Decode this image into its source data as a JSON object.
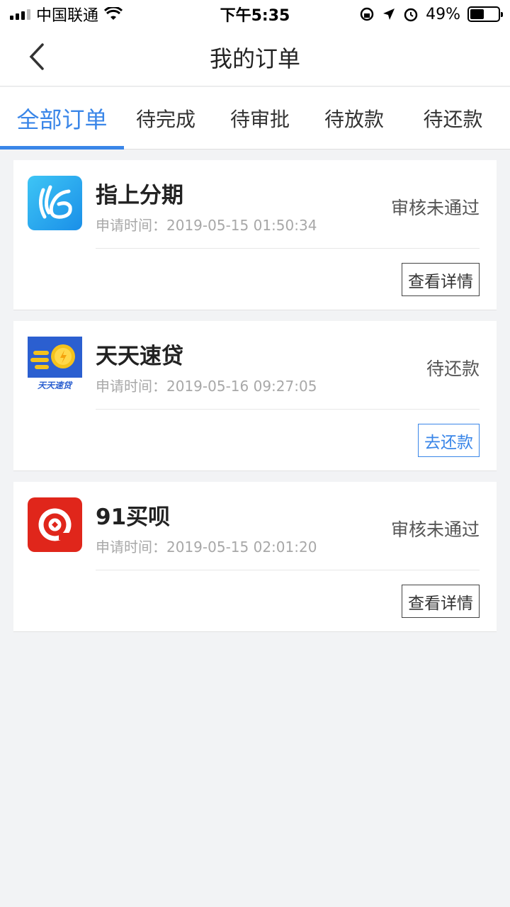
{
  "status_bar": {
    "carrier": "中国联通",
    "time": "下午5:35",
    "battery": "49%",
    "battery_level": 0.49
  },
  "header": {
    "title": "我的订单",
    "back_icon": "chevron-left-icon"
  },
  "tabs": [
    {
      "label": "全部订单",
      "active": true
    },
    {
      "label": "待完成",
      "active": false
    },
    {
      "label": "待审批",
      "active": false
    },
    {
      "label": "待放款",
      "active": false
    },
    {
      "label": "待还款",
      "active": false
    }
  ],
  "orders": [
    {
      "name": "指上分期",
      "time_label": "申请时间：",
      "time": "2019-05-15 01:50:34",
      "status": "审核未通过",
      "action": "查看详情",
      "logo_icon": "zhishang-logo-icon"
    },
    {
      "name": "天天速贷",
      "time_label": "申请时间：",
      "time": "2019-05-16 09:27:05",
      "status": "待还款",
      "action": "去还款",
      "logo_icon": "tiantian-logo-icon",
      "logo_text": "天天速贷"
    },
    {
      "name": "91买呗",
      "time_label": "申请时间：",
      "time": "2019-05-15 02:01:20",
      "status": "审核未通过",
      "action": "查看详情",
      "logo_icon": "maibei-logo-icon"
    }
  ],
  "colors": {
    "accent": "#3a86e8",
    "background": "#f2f3f5"
  }
}
